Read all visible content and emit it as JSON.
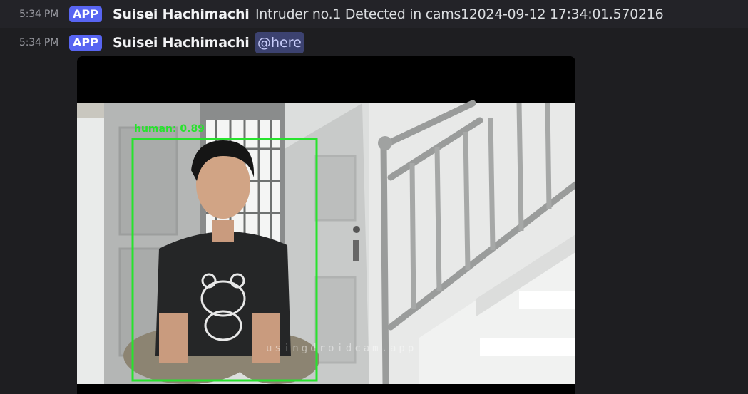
{
  "messages": [
    {
      "time": "5:34 PM",
      "badge": "APP",
      "author": "Suisei Hachimachi",
      "content": "Intruder no.1 Detected in cams12024-09-12 17:34:01.570216"
    },
    {
      "time": "5:34 PM",
      "badge": "APP",
      "author": "Suisei Hachimachi",
      "mention": "@here"
    }
  ],
  "attachment": {
    "detection_label": "human: 0.89",
    "watermark": "usingdroidcam.app",
    "box_color": "#27e32d"
  },
  "colors": {
    "background": "#1e1e21",
    "badge": "#5865f2",
    "mention_bg": "#3c4270",
    "mention_text": "#c9cdfb"
  }
}
